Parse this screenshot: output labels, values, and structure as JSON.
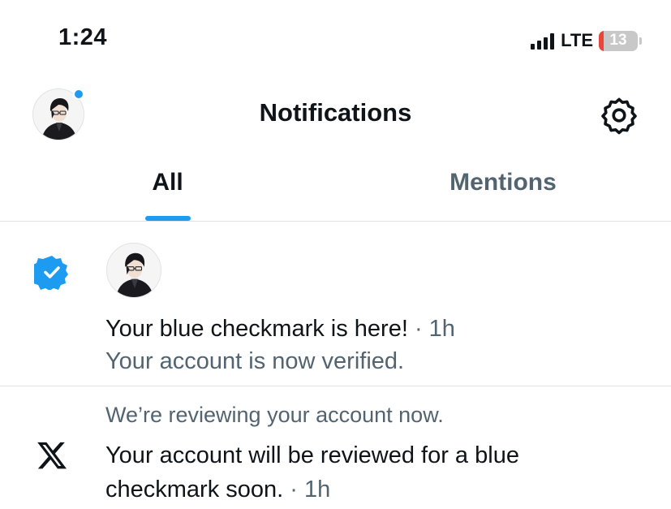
{
  "status_bar": {
    "time": "1:24",
    "network": "LTE",
    "battery_level": "13",
    "battery_fraction": 0.13,
    "battery_color": "#e9463a"
  },
  "header": {
    "title": "Notifications",
    "avatar_icon": "user-avatar",
    "unread_dot_color": "#1d9bf0",
    "settings_icon": "gear-icon"
  },
  "tabs": [
    {
      "label": "All",
      "selected": true
    },
    {
      "label": "Mentions",
      "selected": false
    }
  ],
  "accent_color": "#1d9bf0",
  "notifications": [
    {
      "icon": "verified-badge-icon",
      "title": "Your blue checkmark is here!",
      "time": " · 1h",
      "body": "Your account is now verified."
    },
    {
      "icon": "x-logo-icon",
      "context": "We’re reviewing your account now.",
      "body_line1": "Your account will be reviewed for a blue",
      "body_line2": "checkmark soon.",
      "time": " · 1h"
    }
  ]
}
